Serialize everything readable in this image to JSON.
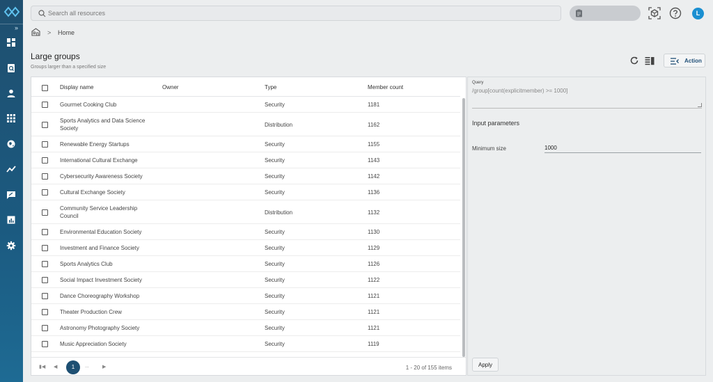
{
  "search": {
    "placeholder": "Search all resources"
  },
  "breadcrumb": {
    "home_icon": "home-icon",
    "current": "Home"
  },
  "page": {
    "title": "Large groups",
    "subtitle": "Groups larger than a specified size"
  },
  "toolbar": {
    "action_label": "Action"
  },
  "user": {
    "initial": "L"
  },
  "colors": {
    "sidebar": "#1f4f6f",
    "accent": "#1d4f72",
    "avatar": "#1a8fd1"
  },
  "table": {
    "columns": [
      "Display name",
      "Owner",
      "Type",
      "Member count"
    ],
    "rows": [
      [
        "Gourmet Cooking Club",
        "",
        "Security",
        "1181"
      ],
      [
        "Sports Analytics and Data Science Society",
        "",
        "Distribution",
        "1162"
      ],
      [
        "Renewable Energy Startups",
        "",
        "Security",
        "1155"
      ],
      [
        "International Cultural Exchange",
        "",
        "Security",
        "1143"
      ],
      [
        "Cybersecurity Awareness Society",
        "",
        "Security",
        "1142"
      ],
      [
        "Cultural Exchange Society",
        "",
        "Security",
        "1136"
      ],
      [
        "Community Service Leadership Council",
        "",
        "Distribution",
        "1132"
      ],
      [
        "Environmental Education Society",
        "",
        "Security",
        "1130"
      ],
      [
        "Investment and Finance Society",
        "",
        "Security",
        "1129"
      ],
      [
        "Sports Analytics Club",
        "",
        "Security",
        "1126"
      ],
      [
        "Social Impact Investment Society",
        "",
        "Security",
        "1122"
      ],
      [
        "Dance Choreography Workshop",
        "",
        "Security",
        "1121"
      ],
      [
        "Theater Production Crew",
        "",
        "Security",
        "1121"
      ],
      [
        "Astronomy Photography Society",
        "",
        "Security",
        "1121"
      ],
      [
        "Music Appreciation Society",
        "",
        "Security",
        "1119"
      ]
    ]
  },
  "pagination": {
    "current_page": "1",
    "ellipsis": "...",
    "info": "1 - 20 of 155 items"
  },
  "query": {
    "label": "Query",
    "text": "/group[count(explicitmember) >= 1000]",
    "params_title": "Input parameters",
    "min_size_label": "Minimum size",
    "min_size_value": "1000",
    "apply_label": "Apply"
  }
}
